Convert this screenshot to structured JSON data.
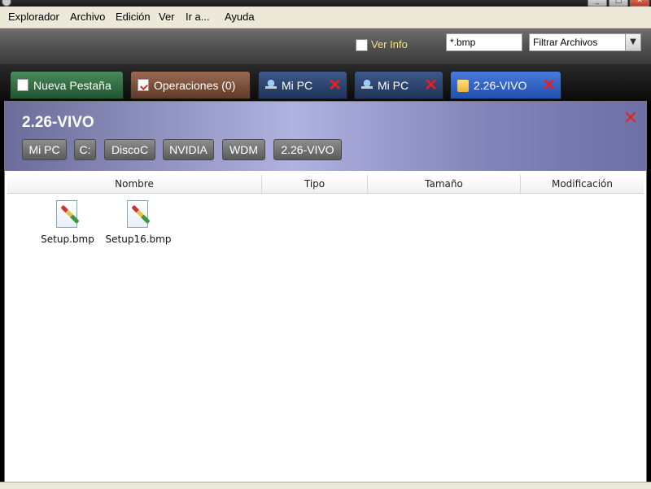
{
  "menu": {
    "items": [
      "Explorador",
      "Archivo",
      "Edición",
      "Ver",
      "Ir a...",
      "Ayuda"
    ]
  },
  "toolbar": {
    "ver_info_label": "Ver Info",
    "filter_value": "*.bmp",
    "filter_select_value": "Filtrar Archivos"
  },
  "tabs": [
    {
      "label": "Nueva Pestaña",
      "icon": "new-document-icon"
    },
    {
      "label": "Operaciones (0)",
      "icon": "operations-icon"
    },
    {
      "label": "Mi PC",
      "icon": "computer-icon"
    },
    {
      "label": "Mi PC",
      "icon": "computer-icon"
    },
    {
      "label": "2.26-VIVO",
      "icon": "folder-open-icon"
    }
  ],
  "path": {
    "title": "2.26-VIVO",
    "breadcrumbs": [
      "Mi PC",
      "C:",
      "DiscoC",
      "NVIDIA",
      "WDM",
      "2.26-VIVO"
    ]
  },
  "columns": [
    "Nombre",
    "Tipo",
    "Tamaño",
    "Modificación"
  ],
  "files": [
    {
      "name": "Setup.bmp",
      "icon": "bitmap-file-icon"
    },
    {
      "name": "Setup16.bmp",
      "icon": "bitmap-file-icon"
    }
  ],
  "colors": {
    "close_red": "#e52020",
    "ver_info_text": "#f2e08a",
    "active_tab": "#2f63c6"
  }
}
